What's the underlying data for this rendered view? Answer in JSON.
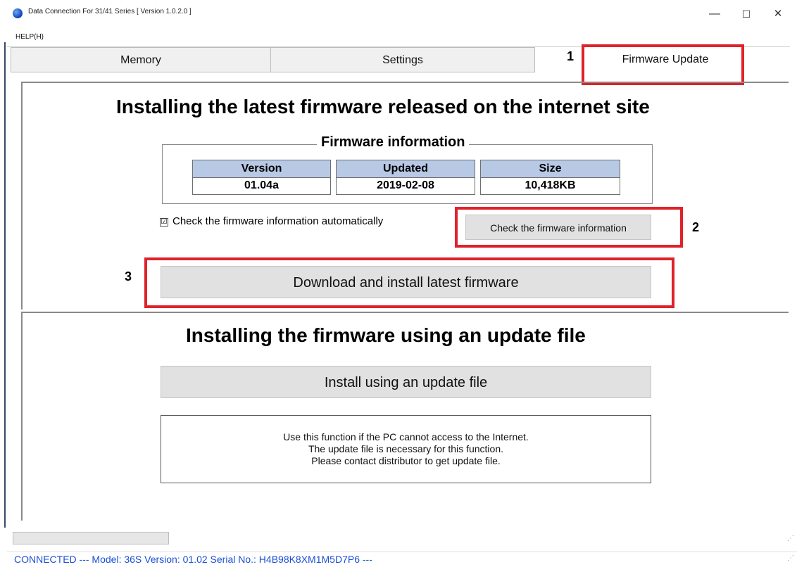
{
  "window": {
    "title": "Data Connection For 31/41 Series   [ Version 1.0.2.0 ]",
    "minimize": "—",
    "maximize": "☐",
    "close": "✕"
  },
  "menu": {
    "help": "HELP(H)"
  },
  "tabs": [
    {
      "label": "Memory"
    },
    {
      "label": "Settings"
    },
    {
      "label": "Firmware Update",
      "active": true
    }
  ],
  "callouts": {
    "n1": "1",
    "n2": "2",
    "n3": "3",
    "color": "#e0222a"
  },
  "online": {
    "heading": "Installing the latest firmware released on the internet site",
    "group_title": "Firmware information",
    "columns": [
      "Version",
      "Updated",
      "Size"
    ],
    "values": [
      "01.04a",
      "2019-02-08",
      "10,418KB"
    ],
    "auto_check_label": "Check the firmware information automatically",
    "auto_check_mark": "☑",
    "check_button": "Check the firmware information",
    "download_button": "Download and install latest firmware"
  },
  "offline": {
    "heading": "Installing the firmware using an update file",
    "install_button": "Install using an update file",
    "info_lines": [
      "Use this function if the PC cannot access to the Internet.",
      "The update file is necessary for this function.",
      "Please contact distributor to get update file."
    ]
  },
  "status": {
    "text": "CONNECTED    ---  Model: 36S   Version: 01.02   Serial No.: H4B98K8XM1M5D7P6   ---",
    "color": "#1a4fd6"
  }
}
